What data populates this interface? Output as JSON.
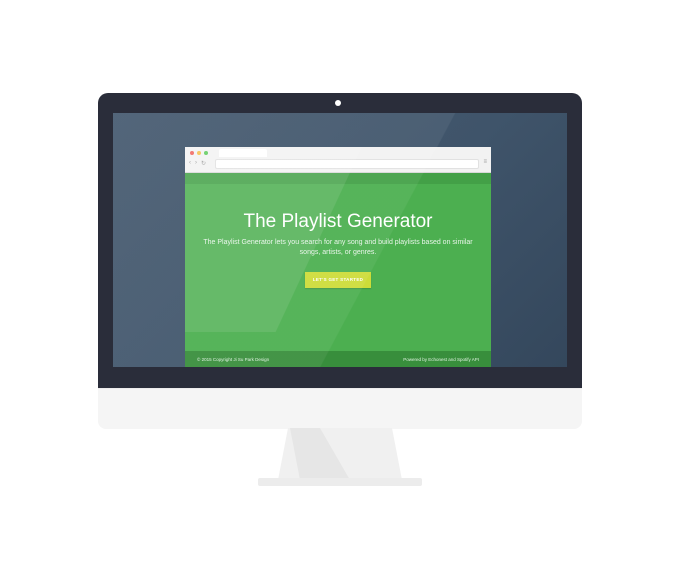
{
  "app": {
    "title": "The Playlist Generator",
    "description": "The Playlist Generator lets you search for any song and build playlists based on similar songs, artists, or genres.",
    "cta_label": "LET'S GET STARTED"
  },
  "footer": {
    "copyright": "© 2015 Copyright Ji Su Park Design",
    "powered_by": "Powered by Echonest and Spotify API"
  },
  "browser": {
    "nav_back": "‹",
    "nav_forward": "›",
    "nav_reload": "↻",
    "menu": "≡"
  },
  "colors": {
    "green": "#4caf50",
    "green_dark": "#388e3c",
    "cta": "#cddc39",
    "monitor_bezel": "#2a2d3a",
    "screen_bg": "#3f546a",
    "dot_red": "#f0645c",
    "dot_yellow": "#f5c04a",
    "dot_green": "#5fcb5c"
  },
  "icons": {
    "window_controls": [
      "close-dot-icon",
      "minimize-dot-icon",
      "zoom-dot-icon"
    ],
    "camera": "camera-icon"
  }
}
